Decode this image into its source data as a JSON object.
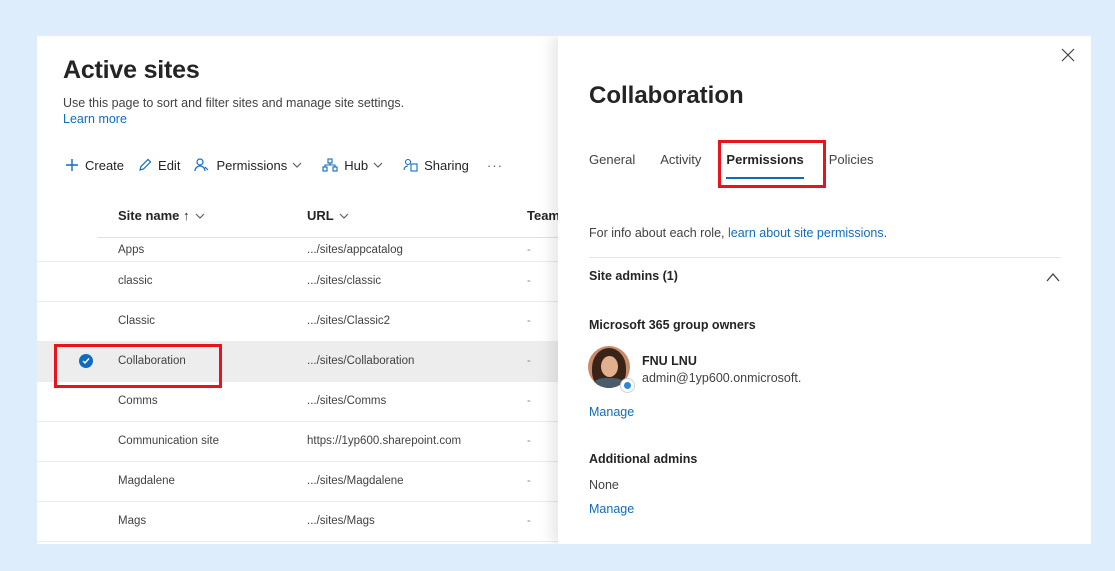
{
  "page": {
    "title": "Active sites",
    "description": "Use this page to sort and filter sites and manage site settings.",
    "learn_more": "Learn more"
  },
  "commands": {
    "create": "Create",
    "edit": "Edit",
    "permissions": "Permissions",
    "hub": "Hub",
    "sharing": "Sharing",
    "more": "···"
  },
  "table": {
    "columns": [
      "Site name ↑",
      "URL",
      "Team"
    ],
    "rows": [
      {
        "name": "Apps",
        "url": ".../sites/appcatalog",
        "team": "-"
      },
      {
        "name": "classic",
        "url": ".../sites/classic",
        "team": "-"
      },
      {
        "name": "Classic",
        "url": ".../sites/Classic2",
        "team": "-"
      },
      {
        "name": "Collaboration",
        "url": ".../sites/Collaboration",
        "team": "-",
        "selected": true
      },
      {
        "name": "Comms",
        "url": ".../sites/Comms",
        "team": "-"
      },
      {
        "name": "Communication site",
        "url": "https://1yp600.sharepoint.com",
        "team": "-"
      },
      {
        "name": "Magdalene",
        "url": ".../sites/Magdalene",
        "team": "-"
      },
      {
        "name": "Mags",
        "url": ".../sites/Mags",
        "team": "-"
      }
    ]
  },
  "panel": {
    "title": "Collaboration",
    "tabs": [
      "General",
      "Activity",
      "Permissions",
      "Policies"
    ],
    "active_tab": "Permissions",
    "info_prefix": "For info about each role, ",
    "info_link": "learn about site permissions",
    "info_suffix": ".",
    "site_admins": "Site admins (1)",
    "group_owners_label": "Microsoft 365 group owners",
    "owner": {
      "name": "FNU LNU",
      "email": "admin@1yp600.onmicrosoft."
    },
    "manage": "Manage",
    "additional_admins": "Additional admins",
    "additional_admins_value": "None"
  },
  "colors": {
    "accent": "#0f6cbd",
    "highlight": "#e8141c",
    "backdrop": "#deedfb"
  },
  "icons": [
    "plus-icon",
    "pencil-icon",
    "people-permissions-icon",
    "hub-icon",
    "sharing-icon",
    "chevron-down-icon",
    "close-icon",
    "chevron-up-icon",
    "checkmark-icon"
  ]
}
